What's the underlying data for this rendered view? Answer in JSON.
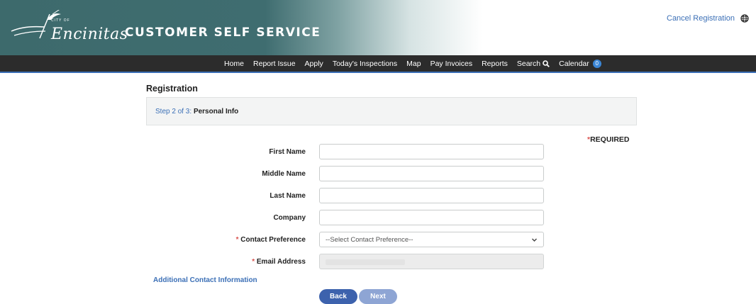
{
  "header": {
    "logo_small_text": "CITY OF",
    "logo_text": "Encinitas",
    "app_title": "CUSTOMER SELF SERVICE",
    "cancel_label": "Cancel Registration",
    "globe_icon": "globe-icon"
  },
  "nav": {
    "items": [
      {
        "label": "Home"
      },
      {
        "label": "Report Issue"
      },
      {
        "label": "Apply"
      },
      {
        "label": "Today's Inspections"
      },
      {
        "label": "Map"
      },
      {
        "label": "Pay Invoices"
      },
      {
        "label": "Reports"
      },
      {
        "label": "Search",
        "icon": "search-icon"
      },
      {
        "label": "Calendar",
        "badge": "0"
      }
    ]
  },
  "main": {
    "page_title": "Registration",
    "step": {
      "progress": "Step 2 of 3:",
      "name": "Personal Info"
    },
    "required_note": "REQUIRED",
    "required_star": "*",
    "fields": {
      "first_name": {
        "label": "First Name",
        "value": ""
      },
      "middle_name": {
        "label": "Middle Name",
        "value": ""
      },
      "last_name": {
        "label": "Last Name",
        "value": ""
      },
      "company": {
        "label": "Company",
        "value": ""
      },
      "contact_preference": {
        "label": "Contact Preference",
        "selected": "--Select Contact Preference--",
        "required": true
      },
      "email": {
        "label": "Email Address",
        "required": true
      }
    },
    "additional_link": "Additional Contact Information",
    "back_label": "Back",
    "next_label": "Next"
  },
  "colors": {
    "banner": "#3f6d70",
    "navbar": "#2c2c2c",
    "link": "#3b6fb6",
    "back_button": "#3d62ad",
    "next_button": "#8ea5d4",
    "required": "#d9534f"
  }
}
